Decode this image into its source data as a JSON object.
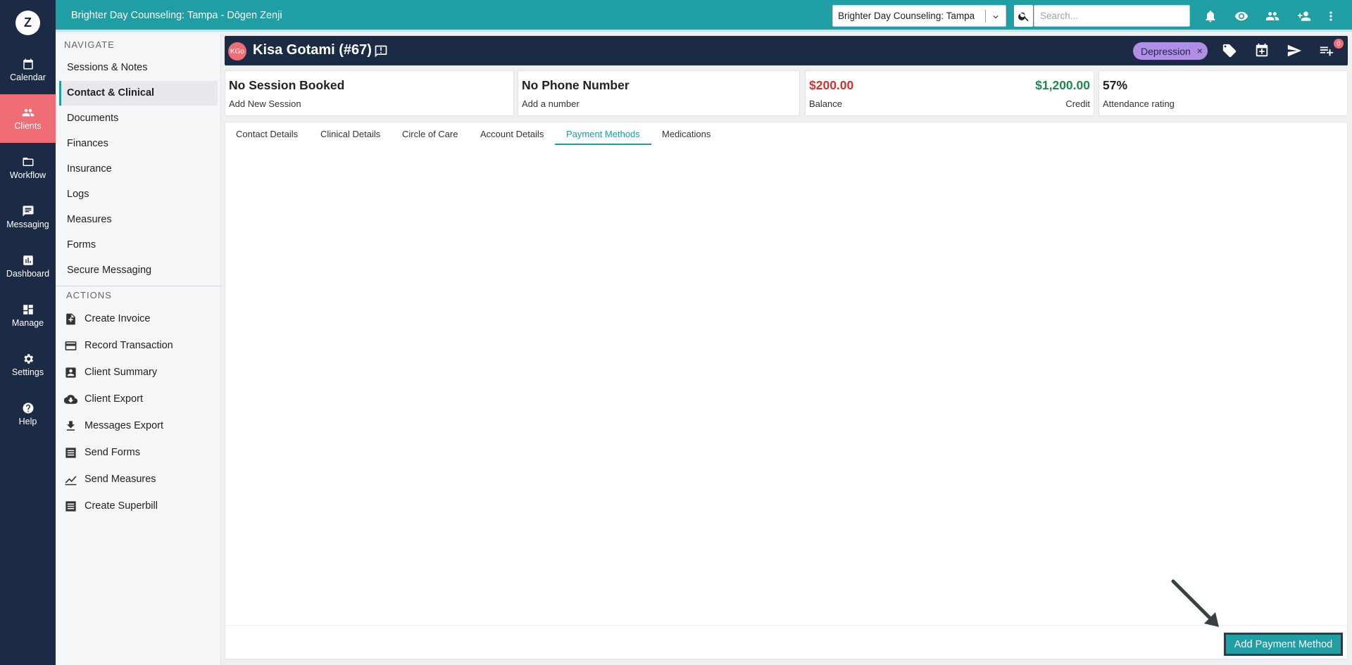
{
  "app": {
    "logo_letter": "Z",
    "header_title": "Brighter Day Counseling: Tampa - Dōgen Zenji"
  },
  "rail": [
    {
      "label": "Calendar",
      "icon": "calendar-icon"
    },
    {
      "label": "Clients",
      "icon": "clients-icon",
      "active": true
    },
    {
      "label": "Workflow",
      "icon": "folder-icon"
    },
    {
      "label": "Messaging",
      "icon": "message-icon"
    },
    {
      "label": "Dashboard",
      "icon": "chart-icon"
    },
    {
      "label": "Manage",
      "icon": "grid-icon"
    },
    {
      "label": "Settings",
      "icon": "gear-icon"
    },
    {
      "label": "Help",
      "icon": "help-icon"
    }
  ],
  "topbar": {
    "practice_select": "Brighter Day Counseling: Tampa",
    "search_placeholder": "Search..."
  },
  "nav": {
    "section_navigate": "NAVIGATE",
    "items": [
      "Sessions & Notes",
      "Contact & Clinical",
      "Documents",
      "Finances",
      "Insurance",
      "Logs",
      "Measures",
      "Forms",
      "Secure Messaging"
    ],
    "active_item": "Contact & Clinical",
    "section_actions": "ACTIONS",
    "actions": [
      {
        "label": "Create Invoice",
        "icon": "invoice-add-icon"
      },
      {
        "label": "Record Transaction",
        "icon": "credit-card-icon"
      },
      {
        "label": "Client Summary",
        "icon": "person-card-icon"
      },
      {
        "label": "Client Export",
        "icon": "cloud-download-icon"
      },
      {
        "label": "Messages Export",
        "icon": "download-icon"
      },
      {
        "label": "Send Forms",
        "icon": "form-icon"
      },
      {
        "label": "Send Measures",
        "icon": "line-chart-icon"
      },
      {
        "label": "Create Superbill",
        "icon": "bill-icon"
      }
    ]
  },
  "client": {
    "initials": "KGo",
    "name": "Kisa Gotami (#67)",
    "tag": "Depression",
    "tag_remove": "×",
    "notification_count": "0"
  },
  "cards": {
    "session_title": "No Session Booked",
    "session_sub": "Add New Session",
    "phone_title": "No Phone Number",
    "phone_sub": "Add a number",
    "balance_value": "$200.00",
    "balance_label": "Balance",
    "credit_value": "$1,200.00",
    "credit_label": "Credit",
    "attendance_value": "57%",
    "attendance_label": "Attendance rating"
  },
  "tabs": [
    "Contact Details",
    "Clinical Details",
    "Circle of Care",
    "Account Details",
    "Payment Methods",
    "Medications"
  ],
  "active_tab": "Payment Methods",
  "footer": {
    "add_button": "Add Payment Method"
  },
  "colors": {
    "teal": "#1f9fa3",
    "navy": "#1c2b45",
    "coral": "#f06d75",
    "tag_purple": "#b08ee6",
    "balance_red": "#d9302c",
    "credit_green": "#1d8a4a"
  }
}
